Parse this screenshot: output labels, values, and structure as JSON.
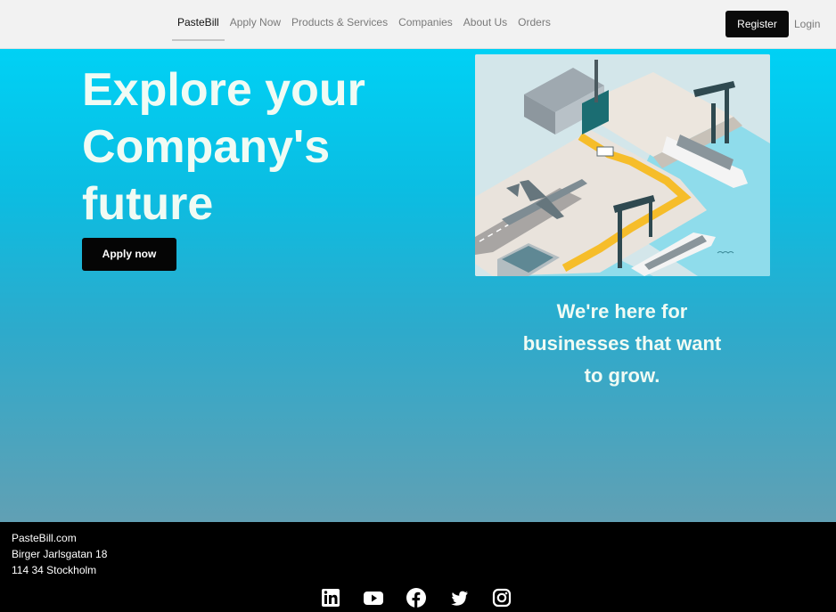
{
  "nav": {
    "links": [
      {
        "label": "PasteBill"
      },
      {
        "label": "Apply Now"
      },
      {
        "label": "Products & Services"
      },
      {
        "label": "Companies"
      },
      {
        "label": "About Us"
      },
      {
        "label": "Orders"
      }
    ],
    "active_index": 0,
    "register_label": "Register",
    "login_label": "Login"
  },
  "hero": {
    "title_lines": [
      "Explore your",
      "Company's",
      "future"
    ],
    "apply_label": "Apply now",
    "illustration_icon": "industrial-port-illustration",
    "tagline_lines": [
      "We're here for",
      "businesses that want",
      "to grow."
    ]
  },
  "footer": {
    "address_lines": [
      "PasteBill.com",
      "Birger Jarlsgatan 18",
      "114 34 Stockholm"
    ],
    "social_icons": [
      "linkedin-icon",
      "youtube-icon",
      "facebook-icon",
      "twitter-icon",
      "instagram-icon"
    ]
  },
  "colors": {
    "hero_top": "#00d1f5",
    "hero_bottom": "#61a0b4",
    "hero_text": "#f0fbf4",
    "nav_bg": "#f2f2f2",
    "button_bg": "#050505"
  }
}
